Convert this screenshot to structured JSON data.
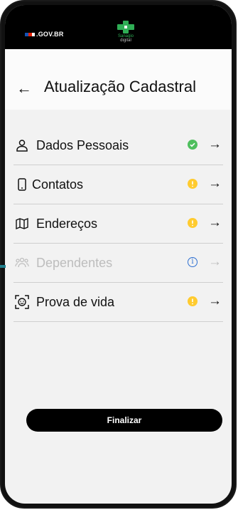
{
  "status_bar": {
    "brand": ".GOV.BR",
    "logo_line1": "Sanagio",
    "logo_line2": "digital"
  },
  "header": {
    "back_icon": "arrow-left-icon",
    "title": "Atualização Cadastral"
  },
  "menu": {
    "items": [
      {
        "icon": "person-icon",
        "label": "Dados Pessoais",
        "status": "ok",
        "status_color": "#4fbf5e",
        "enabled": true
      },
      {
        "icon": "phone-icon",
        "label": "Contatos",
        "status": "warning",
        "status_color": "#ffcb2f",
        "enabled": true
      },
      {
        "icon": "map-icon",
        "label": "Endereços",
        "status": "warning",
        "status_color": "#ffcb2f",
        "enabled": true
      },
      {
        "icon": "group-icon",
        "label": "Dependentes",
        "status": "info",
        "status_color": "#2d6fd1",
        "status_glyph": "i",
        "enabled": false
      },
      {
        "icon": "face-scan-icon",
        "label": "Prova de vida",
        "status": "warning",
        "status_color": "#ffcb2f",
        "enabled": true
      }
    ],
    "arrow_glyph": "→"
  },
  "footer": {
    "finish_label": "Finalizar"
  },
  "colors": {
    "accent": "#000000",
    "ok": "#4fbf5e",
    "warning": "#ffcb2f",
    "info": "#2d6fd1",
    "disabled": "#bdbdbd"
  }
}
